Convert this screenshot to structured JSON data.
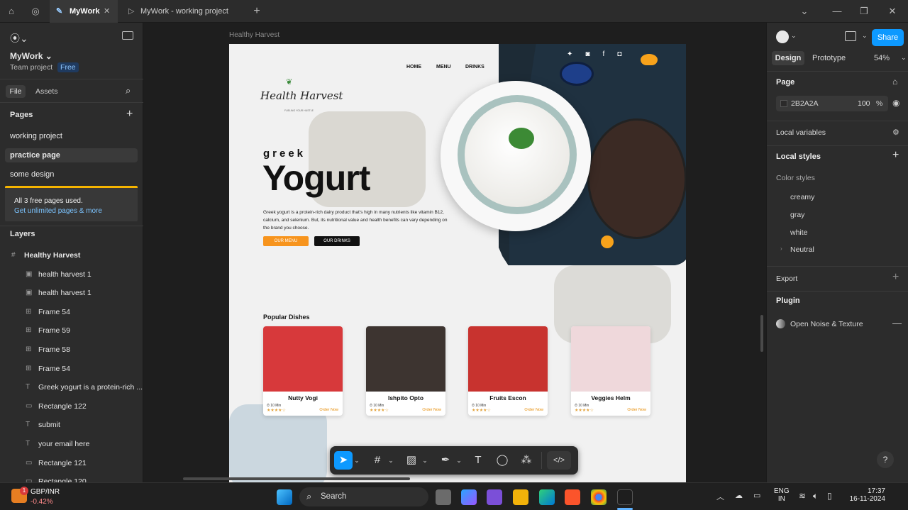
{
  "colors": {
    "accent": "#0d99ff",
    "free_badge": "#1f3a5f",
    "warning_bar": "#f5b400",
    "order_btn": "#f7941d"
  },
  "titlebar": {
    "tab_active": "MyWork",
    "tab_other": "MyWork - working project"
  },
  "left": {
    "team_name": "MyWork",
    "team_sub": "Team project",
    "badge": "Free",
    "tab_file": "File",
    "tab_assets": "Assets",
    "pages_title": "Pages",
    "pages": [
      "working project",
      "practice page",
      "some design"
    ],
    "notice_title": "All 3 free pages used.",
    "notice_link": "Get unlimited pages & more",
    "layers_title": "Layers",
    "layers": [
      {
        "label": "Healthy Harvest",
        "icon": "#"
      },
      {
        "label": "health harvest 1",
        "icon": "▣"
      },
      {
        "label": "health harvest 1",
        "icon": "▣"
      },
      {
        "label": "Frame 54",
        "icon": "⊞"
      },
      {
        "label": "Frame 59",
        "icon": "⊞"
      },
      {
        "label": "Frame 58",
        "icon": "⊞"
      },
      {
        "label": "Frame 54",
        "icon": "⊞"
      },
      {
        "label": "Greek yogurt is a protein-rich ...",
        "icon": "T"
      },
      {
        "label": "Rectangle 122",
        "icon": "▭"
      },
      {
        "label": "submit",
        "icon": "T"
      },
      {
        "label": "your email here",
        "icon": "T"
      },
      {
        "label": "Rectangle 121",
        "icon": "▭"
      },
      {
        "label": "Rectangle 120",
        "icon": "▭"
      }
    ]
  },
  "canvas": {
    "frame_label": "Healthy Harvest"
  },
  "design": {
    "nav": [
      "HOME",
      "MENU",
      "DRINKS"
    ],
    "logo": "Health Harvest",
    "logo_tag": "FUELING YOUR HUSTLE",
    "kicker": "greek",
    "headline": "Yogurt",
    "body": "Greek yogurt is a protein-rich dairy product that's high in many nutrients like vitamin B12, calcium, and selenium. But, its nutritional value and health benefits can vary depending on the brand you choose.",
    "btn_menu": "OUR MENU",
    "btn_drinks": "OUR DRINKS",
    "popular": "Popular Dishes",
    "cards": [
      {
        "name": "Nutty Vogi",
        "time": "10 Min",
        "stars": "★★★★☆",
        "order": "Order Now"
      },
      {
        "name": "Ishpito Opto",
        "time": "10 Min",
        "stars": "★★★★☆",
        "order": "Order Now"
      },
      {
        "name": "Fruits Escon",
        "time": "10 Min",
        "stars": "★★★★☆",
        "order": "Order Now"
      },
      {
        "name": "Veggies Helm",
        "time": "10 Min",
        "stars": "★★★★☆",
        "order": "Order Now"
      }
    ]
  },
  "right": {
    "share": "Share",
    "tab_design": "Design",
    "tab_prototype": "Prototype",
    "zoom": "54%",
    "page_title": "Page",
    "page_color": "2B2A2A",
    "page_opacity": "100",
    "pct": "%",
    "local_variables": "Local variables",
    "local_styles": "Local styles",
    "color_styles": "Color styles",
    "styles": [
      "creamy",
      "gray",
      "white",
      "Neutral"
    ],
    "export": "Export",
    "plugin": "Plugin",
    "plugin_item": "Open Noise & Texture",
    "help": "?"
  },
  "taskbar": {
    "ticker": "GBP/INR",
    "change": "-0.42%",
    "search": "Search",
    "lang1": "ENG",
    "lang2": "IN",
    "time": "17:37",
    "date": "16-11-2024",
    "notif": "1"
  }
}
